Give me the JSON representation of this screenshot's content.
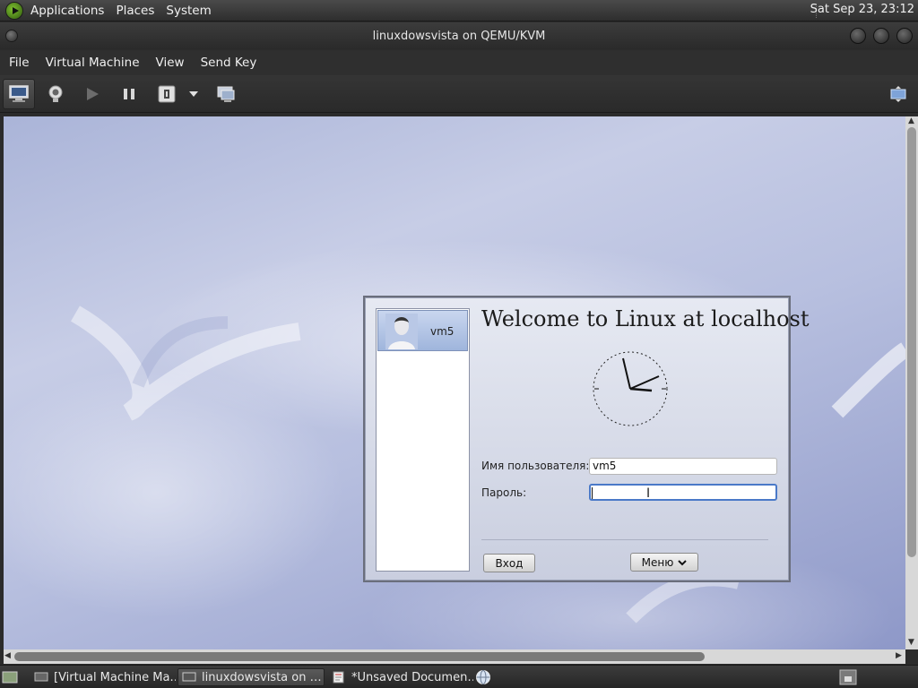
{
  "top_panel": {
    "menu": [
      "Applications",
      "Places",
      "System"
    ],
    "clock": "Sat Sep 23, 23:12"
  },
  "window": {
    "title": "linuxdowsvista on QEMU/KVM"
  },
  "menubar": [
    "File",
    "Virtual Machine",
    "View",
    "Send Key"
  ],
  "toolbar": {
    "icons": [
      "console-icon",
      "details-icon",
      "run-icon",
      "pause-icon",
      "shutdown-icon",
      "dropdown-arrow-icon",
      "screenshot-icon",
      "fullscreen-icon"
    ]
  },
  "login": {
    "welcome": "Welcome to Linux at localhost",
    "user_entry": "vm5",
    "username_label": "Имя пользователя:",
    "username_value": "vm5",
    "password_label": "Пароль:",
    "password_value": "",
    "login_button": "Вход",
    "menu_button": "Меню"
  },
  "taskbar": {
    "items": [
      "[Virtual Machine Ma…",
      "linuxdowsvista on …",
      "*Unsaved Documen…"
    ]
  },
  "colors": {
    "panel_bg": "#2e2e2e",
    "focus_border": "#4a79c8",
    "desktop_blue": "#aab4d8"
  }
}
